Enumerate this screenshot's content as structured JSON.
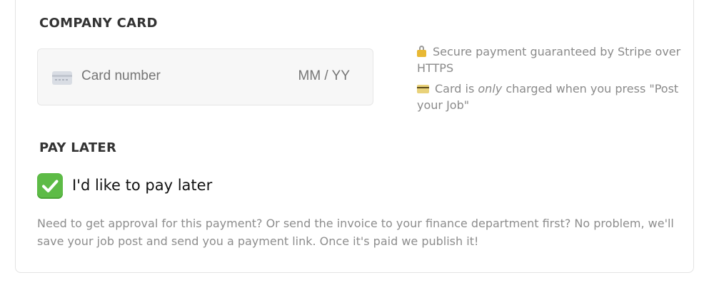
{
  "company_card": {
    "heading": "COMPANY CARD",
    "card_number_placeholder": "Card number",
    "expiry_placeholder": "MM / YY",
    "card_icon": "credit-card-icon"
  },
  "info": {
    "secure_icon": "lock-icon",
    "secure_text": "Secure payment guaranteed by Stripe over HTTPS",
    "charged_icon": "credit-card-icon",
    "charged_prefix": "Card is ",
    "charged_emphasis": "only",
    "charged_suffix": " charged when you press \"Post your Job\""
  },
  "pay_later": {
    "heading": "PAY LATER",
    "checkbox_checked": true,
    "checkbox_label": "I'd like to pay later",
    "description": "Need to get approval for this payment? Or send the invoice to your finance department first? No problem, we'll save your job post and send you a payment link. Once it's paid we publish it!"
  },
  "colors": {
    "checkbox_green": "#5dbb46",
    "muted_text": "#8a8a8a",
    "heading_text": "#333333"
  }
}
